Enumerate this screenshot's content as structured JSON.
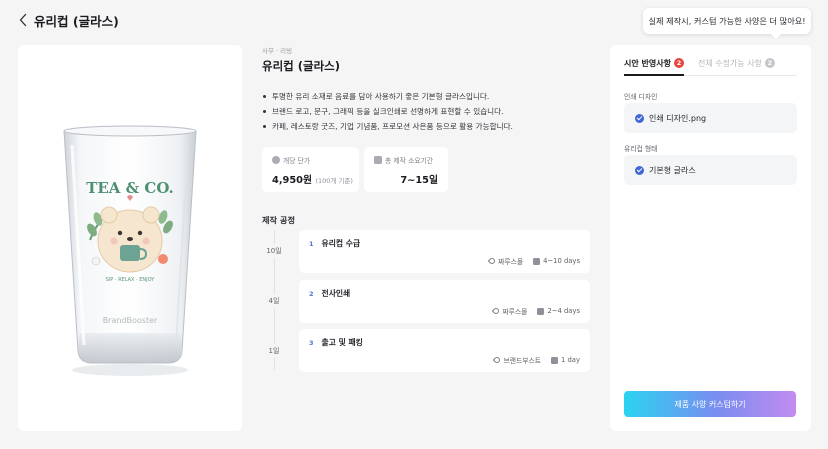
{
  "header": {
    "title": "유리컵 (글라스)"
  },
  "tooltip": {
    "text": "실제 제작시, 커스텀 가능한 사양은 더 많아요!"
  },
  "product": {
    "image": {
      "logo_text": "TEA & CO.",
      "tagline": "SIP · RELAX · ENJOY",
      "brand_mark": "BrandBooster"
    },
    "category": "사무 · 리빙",
    "title": "유리컵 (글라스)",
    "bullets": [
      "투명한 유리 소재로 음료를 담아 사용하기 좋은 기본형 글라스입니다.",
      "브랜드 로고, 문구, 그래픽 등을 실크인쇄로 선명하게 표현할 수 있습니다.",
      "카페, 레스토랑 굿즈, 기업 기념품, 프로모션 사은품 등으로 활용 가능합니다."
    ],
    "stats": {
      "unit_price_label": "개당 단가",
      "unit_price_value": "4,950원",
      "unit_price_note": "(100개 기준)",
      "lead_time_label": "총 제작 소요기간",
      "lead_time_value": "7~15일"
    }
  },
  "process": {
    "title": "제작 공정",
    "steps": [
      {
        "days": "10일",
        "num": "1",
        "name": "유리컵 수급",
        "vendor": "짜루스몰",
        "duration": "4~10 days"
      },
      {
        "days": "4일",
        "num": "2",
        "name": "전사인쇄",
        "vendor": "짜루스몰",
        "duration": "2~4 days"
      },
      {
        "days": "1일",
        "num": "3",
        "name": "출고 및 패킹",
        "vendor": "브랜드부스트",
        "duration": "1 day"
      }
    ]
  },
  "side_panel": {
    "tabs": [
      {
        "label": "시안 반영사항",
        "count": "2",
        "active": true
      },
      {
        "label": "전체 수정가능 사항",
        "count": "2",
        "active": false
      }
    ],
    "options": [
      {
        "label": "인쇄 디자인",
        "value": "인쇄 디자인.png"
      },
      {
        "label": "유리컵 형태",
        "value": "기본형 글라스"
      }
    ],
    "cta_label": "제품 사양 커스텀하기"
  },
  "colors": {
    "accent": "#4166d5",
    "badge_active": "#e8453c",
    "badge_inactive": "#c4c6cb",
    "cta_gradient_start": "#2bd3f0",
    "cta_gradient_end": "#c28cf0",
    "background": "#f5f5f6"
  },
  "icons": [
    "chevron-left-icon",
    "coin-icon",
    "calendar-icon",
    "wrench-icon",
    "check-circle-icon"
  ]
}
